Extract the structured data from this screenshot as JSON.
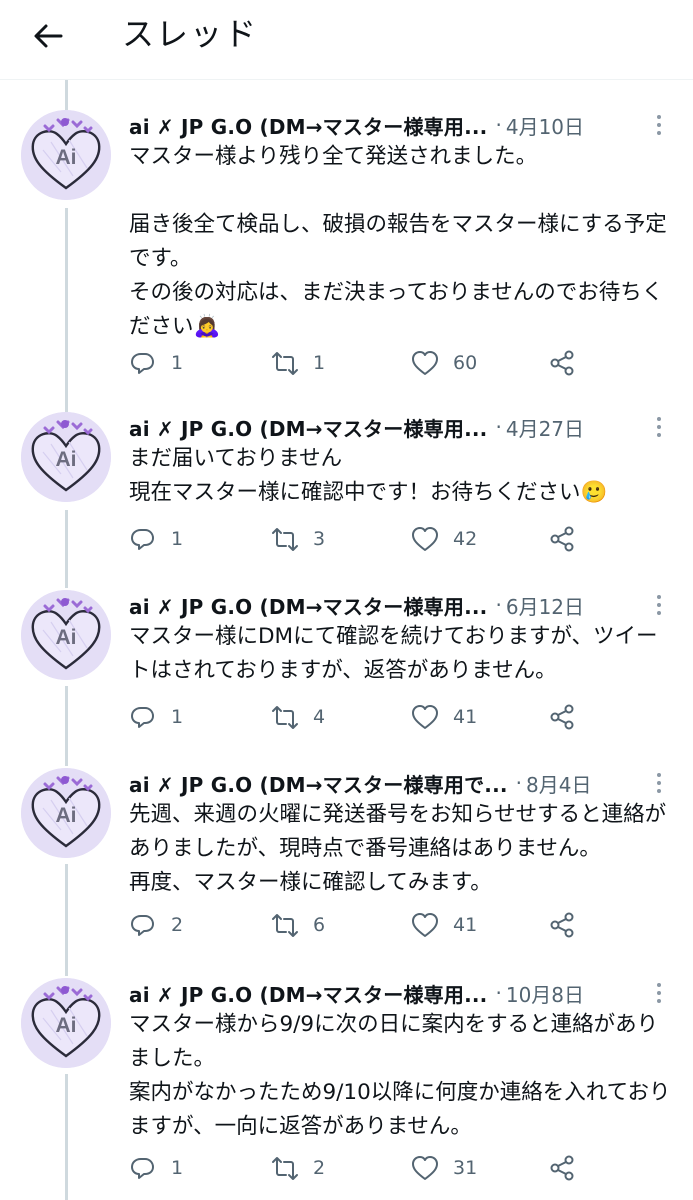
{
  "header": {
    "title": "スレッド"
  },
  "icons": {
    "back": "arrow-left-icon",
    "reply": "reply-icon",
    "retweet": "retweet-icon",
    "like": "heart-icon",
    "share": "share-icon",
    "more": "more-vertical-icon"
  },
  "colors": {
    "text": "#0f1419",
    "muted": "#536471",
    "avatar_bg": "#e4def6",
    "thread_line": "#cfd9de"
  },
  "tweets": [
    {
      "author": "ai ✗ JP G.O (DM→マスター様専用...",
      "dot": "·",
      "date": "4月10日",
      "avatar_text": "Ai",
      "text": "マスター様より残り全て発送されました。\n\n届き後全て検品し、破損の報告をマスター様にする予定です。\nその後の対応は、まだ決まっておりませんのでお待ちください🙇‍♀️",
      "replies": "1",
      "retweets": "1",
      "likes": "60"
    },
    {
      "author": "ai ✗ JP G.O (DM→マスター様専用...",
      "dot": "·",
      "date": "4月27日",
      "avatar_text": "Ai",
      "text": "まだ届いておりません\n現在マスター様に確認中です！お待ちください🥲",
      "replies": "1",
      "retweets": "3",
      "likes": "42"
    },
    {
      "author": "ai ✗ JP G.O (DM→マスター様専用...",
      "dot": "·",
      "date": "6月12日",
      "avatar_text": "Ai",
      "text": "マスター様にDMにて確認を続けておりますが、ツイートはされておりますが、返答がありません。",
      "replies": "1",
      "retweets": "4",
      "likes": "41"
    },
    {
      "author": "ai ✗ JP G.O (DM→マスター様専用で...",
      "dot": "·",
      "date": "8月4日",
      "avatar_text": "Ai",
      "text": "先週、来週の火曜に発送番号をお知らせせすると連絡がありましたが、現時点で番号連絡はありません。\n再度、マスター様に確認してみます。",
      "replies": "2",
      "retweets": "6",
      "likes": "41"
    },
    {
      "author": "ai ✗ JP G.O (DM→マスター様専用...",
      "dot": "·",
      "date": "10月8日",
      "avatar_text": "Ai",
      "text": "マスター様から9/9に次の日に案内をすると連絡がありました。\n案内がなかったため9/10以降に何度か連絡を入れておりますが、一向に返答がありません。",
      "replies": "1",
      "retweets": "2",
      "likes": "31"
    }
  ]
}
